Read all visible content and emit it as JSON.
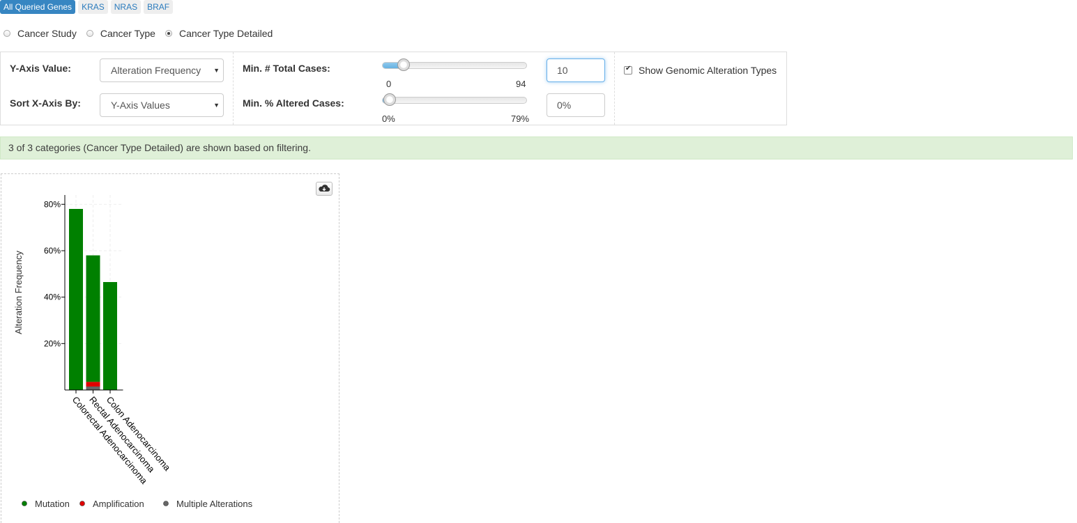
{
  "gene_tabs": [
    {
      "label": "All Queried Genes",
      "active": true
    },
    {
      "label": "KRAS",
      "active": false
    },
    {
      "label": "NRAS",
      "active": false
    },
    {
      "label": "BRAF",
      "active": false
    }
  ],
  "group_by": {
    "options": [
      "Cancer Study",
      "Cancer Type",
      "Cancer Type Detailed"
    ],
    "selected": "Cancer Type Detailed"
  },
  "controls": {
    "y_axis_label": "Y-Axis Value:",
    "y_axis_value": "Alteration Frequency",
    "sort_label": "Sort X-Axis By:",
    "sort_value": "Y-Axis Values",
    "min_total_label": "Min. # Total Cases:",
    "min_total_min": "0",
    "min_total_max": "94",
    "min_total_value": "10",
    "min_total_fraction": 0.106,
    "min_altered_label": "Min. % Altered Cases:",
    "min_altered_min": "0%",
    "min_altered_max": "79%",
    "min_altered_value": "0%",
    "min_altered_fraction": 0,
    "show_types_label": "Show Genomic Alteration Types",
    "show_types_checked": true
  },
  "alert": "3 of 3 categories (Cancer Type Detailed) are shown based on filtering.",
  "icons": {
    "download": "cloud-download-icon"
  },
  "colors": {
    "mutation": "#008000",
    "amplification": "#e00000",
    "multiple": "#666666",
    "accent": "#3786c2"
  },
  "chart_data": {
    "type": "bar",
    "stacked": true,
    "ylabel": "Alteration Frequency",
    "ylim": [
      0,
      84
    ],
    "yticks": [
      20,
      40,
      60,
      80
    ],
    "ytick_labels": [
      "20%",
      "40%",
      "60%",
      "80%"
    ],
    "categories": [
      "Colorectal Adenocarcinoma",
      "Rectal Adenocarcinoma",
      "Colon Adenocarcinoma"
    ],
    "series": [
      {
        "name": "Multiple Alterations",
        "color": "#666666",
        "values": [
          0,
          1.5,
          0
        ]
      },
      {
        "name": "Amplification",
        "color": "#e00000",
        "values": [
          0,
          2,
          0
        ]
      },
      {
        "name": "Mutation",
        "color": "#008000",
        "values": [
          78,
          54.5,
          46.5
        ]
      }
    ],
    "legend": {
      "placement": "bottom",
      "entries": [
        {
          "label": "Mutation",
          "color": "#008000"
        },
        {
          "label": "Amplification",
          "color": "#e00000"
        },
        {
          "label": "Multiple Alterations",
          "color": "#666666"
        }
      ]
    }
  }
}
